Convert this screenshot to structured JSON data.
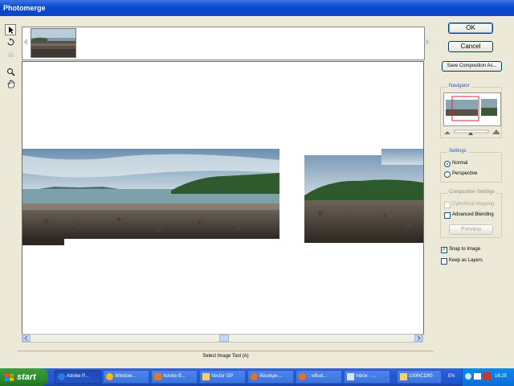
{
  "window": {
    "title": "Photomerge"
  },
  "toolbar": {
    "tools": [
      "select-image-icon",
      "rotate-image-icon",
      "vanishing-point-icon",
      "zoom-icon",
      "hand-icon"
    ],
    "selected": "select-image-icon"
  },
  "right_panel": {
    "ok_label": "OK",
    "cancel_label": "Cancel",
    "save_composition_label": "Save Composition As...",
    "navigator": {
      "title": "Navigator"
    },
    "settings": {
      "title": "Settings",
      "normal_label": "Normal",
      "perspective_label": "Perspective",
      "selected": "Normal"
    },
    "composition_settings": {
      "title": "Composition Settings",
      "cylindrical_label": "Cylindrical Mapping",
      "advanced_blending_label": "Advanced Blending",
      "preview_label": "Preview"
    },
    "snap_to_image_label": "Snap to Image",
    "snap_to_image_checked": true,
    "keep_as_layers_label": "Keep as Layers",
    "keep_as_layers_checked": false
  },
  "status": {
    "text": "Select Image Tool (A)"
  },
  "taskbar": {
    "start_label": "start",
    "tasks": [
      {
        "label": "Adobe P...",
        "active": true
      },
      {
        "label": "Window...",
        "active": false
      },
      {
        "label": "Adobe B...",
        "active": false
      },
      {
        "label": "Vector GP",
        "active": false
      },
      {
        "label": "ห้องสมุด-...",
        "active": false
      },
      {
        "label": ":: eBud...",
        "active": false
      },
      {
        "label": "Inbox - ...",
        "active": false
      },
      {
        "label": "100NCD90",
        "active": false
      }
    ],
    "language": "EN",
    "clock": "16:25"
  },
  "colors": {
    "title_bar": "#0a49cf",
    "taskbar": "#245edb",
    "start_button": "#2f8a2f",
    "dialog_bg": "#ece9d8"
  }
}
